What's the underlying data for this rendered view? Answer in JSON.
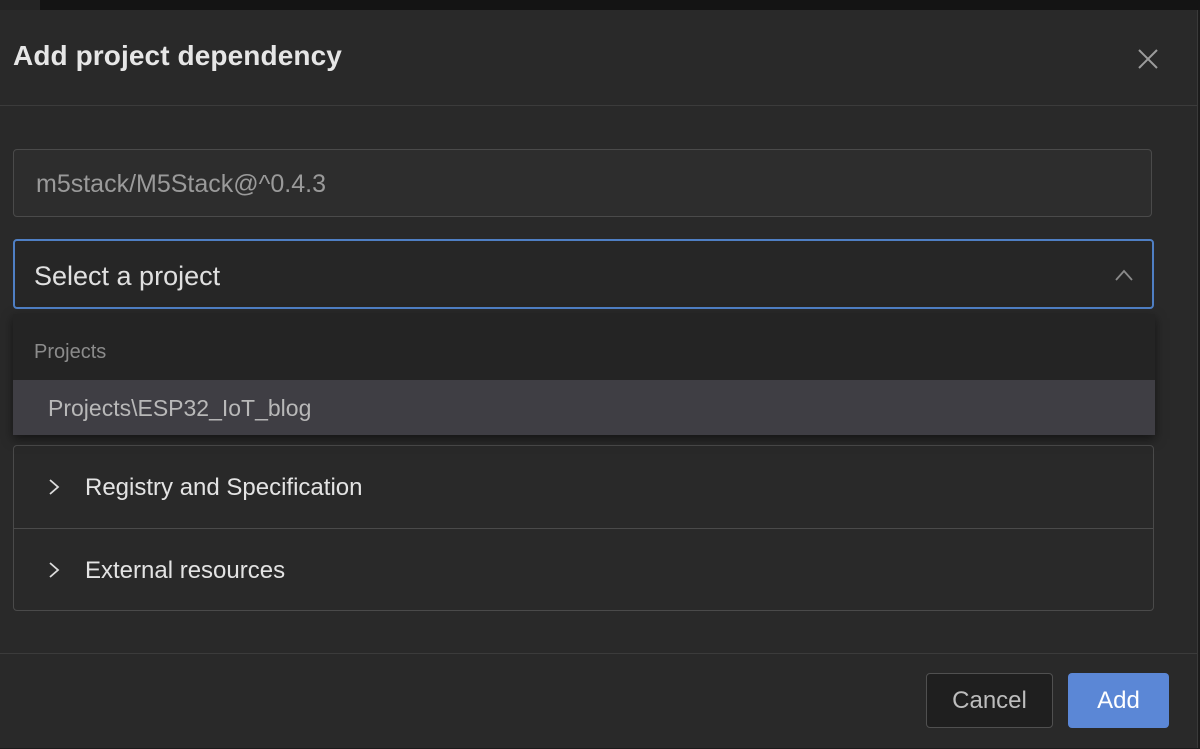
{
  "dialog": {
    "title": "Add project dependency"
  },
  "dependency_input": {
    "value": "",
    "placeholder": "m5stack/M5Stack@^0.4.3"
  },
  "project_select": {
    "placeholder": "Select a project",
    "expanded": true,
    "group_label": "Projects",
    "options": [
      {
        "label": "Projects\\ESP32_IoT_blog",
        "highlighted": true
      }
    ]
  },
  "sections": [
    {
      "label": "Registry and Specification",
      "expanded": false
    },
    {
      "label": "External resources",
      "expanded": false
    }
  ],
  "footer": {
    "cancel_label": "Cancel",
    "add_label": "Add"
  },
  "colors": {
    "dialog_bg": "#292929",
    "focus_border": "#4f7fc4",
    "primary_button": "#5b87d6",
    "highlight_option": "#3f3e44"
  },
  "icons": {
    "close": "close-icon",
    "select_toggle": "chevron-up-icon",
    "section_toggle": "chevron-right-icon"
  }
}
